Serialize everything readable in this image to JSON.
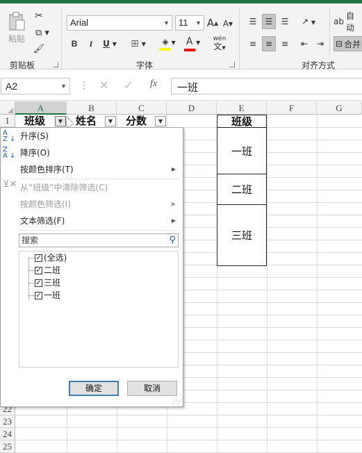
{
  "ribbon": {
    "clipboard": {
      "label": "剪贴板",
      "paste_label": "粘贴"
    },
    "font": {
      "label": "字体",
      "name": "Arial",
      "size": "11",
      "grow": "A",
      "shrink": "A",
      "bold": "B",
      "italic": "I",
      "underline": "U",
      "font_color_letter": "A",
      "phonetic_top": "wén",
      "phonetic_bottom": "文"
    },
    "alignment": {
      "label": "对齐方式",
      "wrap_label": "自动",
      "merge_label": "合并"
    },
    "colors": {
      "accent": "#217346",
      "fill_color": "#ffff00",
      "font_color": "#ff0000"
    }
  },
  "formula_bar": {
    "name_box": "A2",
    "fx": "fx",
    "content": "一班"
  },
  "columns": [
    "A",
    "B",
    "C",
    "D",
    "E",
    "F",
    "G"
  ],
  "rows": [
    "1",
    "22",
    "23",
    "24",
    "25"
  ],
  "headers": {
    "a1": "班级",
    "b1": "姓名",
    "c1": "分数",
    "e1": "班级"
  },
  "e_column": [
    "一班",
    "二班",
    "三班"
  ],
  "filter_menu": {
    "sort_asc": "升序(S)",
    "sort_desc": "降序(O)",
    "sort_color": "按颜色排序(T)",
    "clear_filter": "从“班级”中清除筛选(C)",
    "color_filter": "按颜色筛选(I)",
    "text_filter": "文本筛选(F)",
    "search_placeholder": "搜索",
    "items": [
      "(全选)",
      "二班",
      "三班",
      "一班"
    ],
    "ok": "确定",
    "cancel": "取消"
  }
}
